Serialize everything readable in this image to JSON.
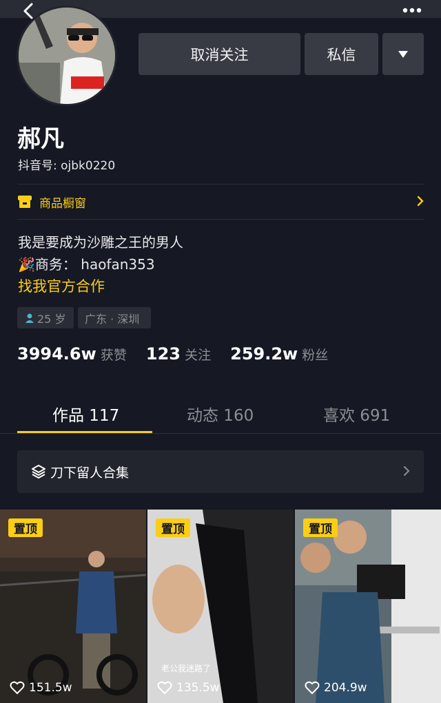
{
  "header": {
    "back_icon": "chevron-left-icon",
    "more_icon": "more-dots-icon"
  },
  "profile": {
    "name": "郝凡",
    "uid": "抖音号: ojbk0220",
    "avatar_icon": "avatar-photo"
  },
  "actions": {
    "unfollow": "取消关注",
    "message": "私信",
    "dropdown_icon": "triangle-down-icon"
  },
  "shop": {
    "label": "商品橱窗",
    "icon": "shop-icon"
  },
  "bio": {
    "line1": "我是要成为沙雕之王的男人",
    "line2_emoji": "🎉",
    "line2": "商务：  haofan353",
    "link": "找我官方合作"
  },
  "tags": {
    "age": "25 岁",
    "location": "广东 · 深圳"
  },
  "stats": {
    "likes_value": "3994.6w",
    "likes_label": "获赞",
    "following_value": "123",
    "following_label": "关注",
    "followers_value": "259.2w",
    "followers_label": "粉丝"
  },
  "tabs": [
    {
      "label": "作品 117"
    },
    {
      "label": "动态 160"
    },
    {
      "label": "喜欢 691"
    }
  ],
  "collection": {
    "label": "刀下留人合集"
  },
  "videos": [
    {
      "pin": "置顶",
      "likes": "151.5w",
      "caption": ""
    },
    {
      "pin": "置顶",
      "likes": "135.5w",
      "caption": "老公我迷路了"
    },
    {
      "pin": "置顶",
      "likes": "204.9w",
      "caption": ""
    }
  ],
  "colors": {
    "background": "#161823",
    "accent": "#face15",
    "button": "#393b44"
  }
}
